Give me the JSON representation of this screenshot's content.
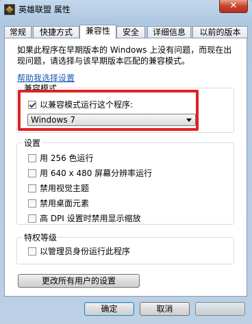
{
  "window": {
    "title": "英雄联盟 属性",
    "close_glyph": "✕"
  },
  "tabs": [
    {
      "label": "常规"
    },
    {
      "label": "快捷方式"
    },
    {
      "label": "兼容性"
    },
    {
      "label": "安全"
    },
    {
      "label": "详细信息"
    },
    {
      "label": "以前的版本"
    }
  ],
  "active_tab": "兼容性",
  "intro_line1": "如果此程序在早期版本的 Windows 上没有问题，而现在出",
  "intro_line2": "现问题，请选择与该早期版本匹配的兼容模式。",
  "help_link": "帮助我选择设置",
  "compat": {
    "title": "兼容模式",
    "checkbox_label": "以兼容模式运行这个程序:",
    "checked": true,
    "selected_os": "Windows 7"
  },
  "settings": {
    "title": "设置",
    "items": [
      {
        "label": "用 256 色运行",
        "checked": false
      },
      {
        "label": "用 640 x 480 屏幕分辨率运行",
        "checked": false
      },
      {
        "label": "禁用视觉主题",
        "checked": false
      },
      {
        "label": "禁用桌面元素",
        "checked": false
      },
      {
        "label": "高 DPI 设置时禁用显示缩放",
        "checked": false
      }
    ]
  },
  "privilege": {
    "title": "特权等级",
    "checkbox_label": "以管理员身份运行此程序",
    "checked": false
  },
  "buttons": {
    "change_all": "更改所有用户的设置",
    "ok": "确定",
    "cancel": "取消"
  },
  "colors": {
    "highlight_box": "#e02020",
    "link": "#1a55b5"
  }
}
